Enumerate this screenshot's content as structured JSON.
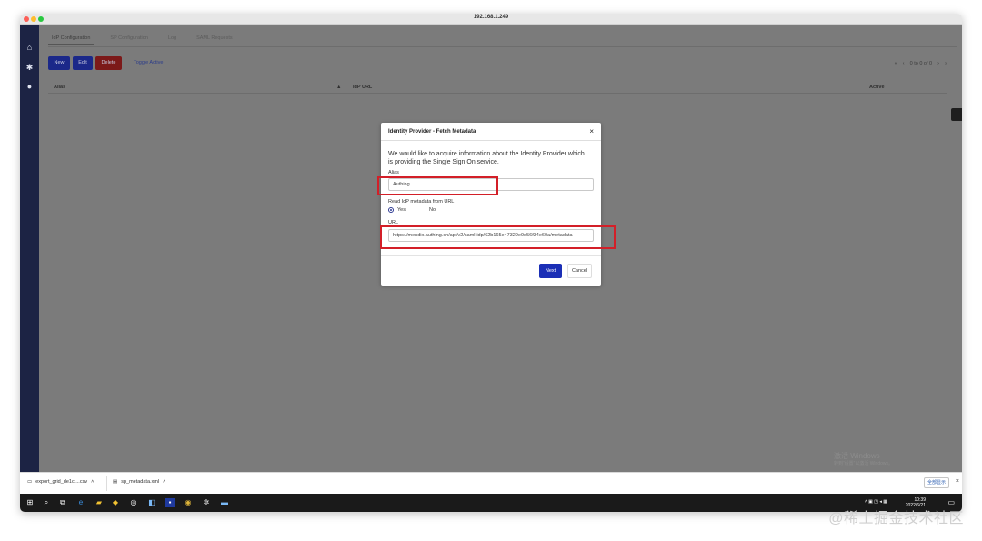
{
  "window": {
    "title": "192.168.1.249"
  },
  "tabs": [
    {
      "label": "IdP Configuration",
      "active": true
    },
    {
      "label": "SP Configuration",
      "active": false
    },
    {
      "label": "Log",
      "active": false
    },
    {
      "label": "SAML Requests",
      "active": false
    }
  ],
  "toolbar": {
    "new_label": "New",
    "edit_label": "Edit",
    "delete_label": "Delete",
    "toggle_label": "Toggle Active"
  },
  "pager": {
    "first": "«",
    "prev": "‹",
    "status": "0 to 0 of 0",
    "next": "›",
    "last": "»"
  },
  "grid": {
    "columns": [
      "Alias",
      "▲",
      "IdP URL",
      "Active"
    ]
  },
  "dialog": {
    "title": "Identity Provider - Fetch Metadata",
    "close": "×",
    "intro": "We would like to acquire information about the Identity Provider which is providing the Single Sign On service.",
    "alias_label": "Alias",
    "alias_value": "Authing",
    "read_label": "Read IdP metadata from URL",
    "yes_label": "Yes",
    "no_label": "No",
    "url_label": "URL",
    "url_value": "https://mendix.authing.cn/api/v2/saml-idp/62b165e47329e9d56f34e60a/metadata",
    "next_label": "Next",
    "cancel_label": "Cancel"
  },
  "windows_watermark": {
    "line1": "激活 Windows",
    "line2": "转到“设置”以激活 Windows。"
  },
  "downloads": [
    {
      "name": "export_grid_de1c....csv"
    },
    {
      "name": "sp_metadata.xml"
    }
  ],
  "downloads_show_all": "全部显示",
  "downloads_close": "×",
  "taskbar": {
    "time": "10:39",
    "date": "2022/6/21"
  },
  "footer_watermark": "@稀土掘金技术社区",
  "colors": {
    "sidebar": "#1c2344",
    "primary": "#1b2fb6",
    "danger": "#7c1919",
    "highlight": "#d31f28"
  }
}
